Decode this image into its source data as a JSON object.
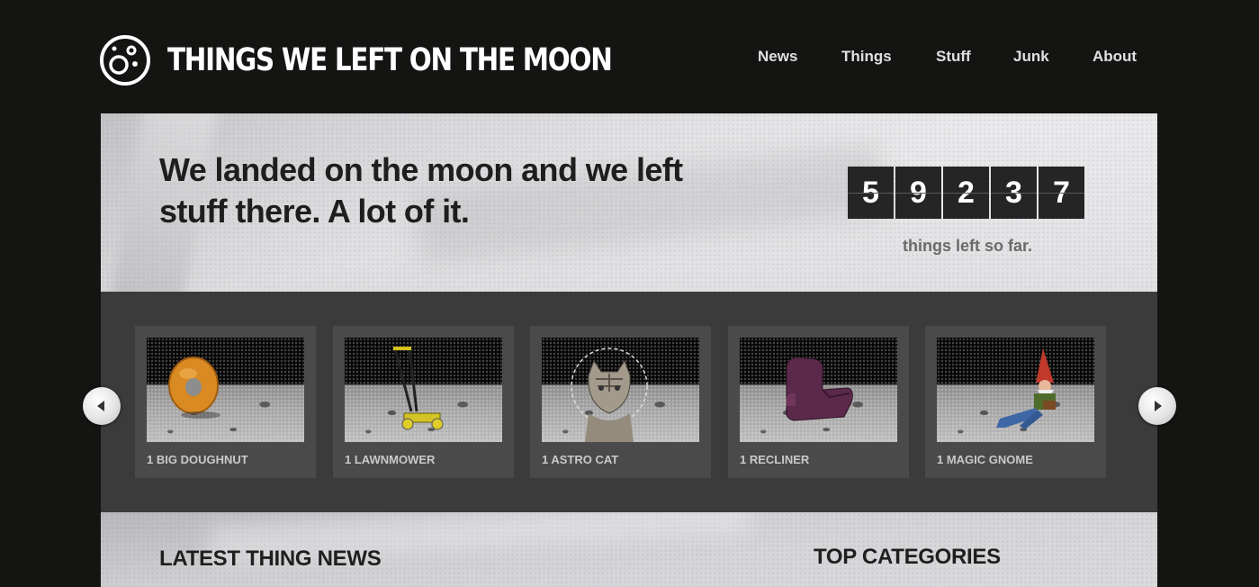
{
  "header": {
    "logo_text": "THINGS WE LEFT ON THE MOON",
    "logo_icon": "moon-icon",
    "nav": [
      "News",
      "Things",
      "Stuff",
      "Junk",
      "About"
    ]
  },
  "hero": {
    "headline": "We landed on the moon and we left stuff there. A lot of it.",
    "counter_digits": [
      "5",
      "9",
      "2",
      "3",
      "7"
    ],
    "counter_caption": "things left so far."
  },
  "carousel": {
    "prev_icon": "chevron-left-icon",
    "next_icon": "chevron-right-icon",
    "items": [
      {
        "label": "1 BIG DOUGHNUT",
        "icon": "doughnut-icon"
      },
      {
        "label": "1 LAWNMOWER",
        "icon": "lawnmower-icon"
      },
      {
        "label": "1 ASTRO CAT",
        "icon": "cat-icon"
      },
      {
        "label": "1 RECLINER",
        "icon": "recliner-icon"
      },
      {
        "label": "1 MAGIC GNOME",
        "icon": "gnome-icon"
      }
    ]
  },
  "sections": {
    "latest_news_title": "LATEST THING NEWS",
    "top_categories_title": "TOP CATEGORIES"
  },
  "colors": {
    "background": "#141513",
    "carousel_bg": "#3b3b3b",
    "card_bg": "#4a4a4a",
    "counter_digit_bg": "#252525"
  }
}
